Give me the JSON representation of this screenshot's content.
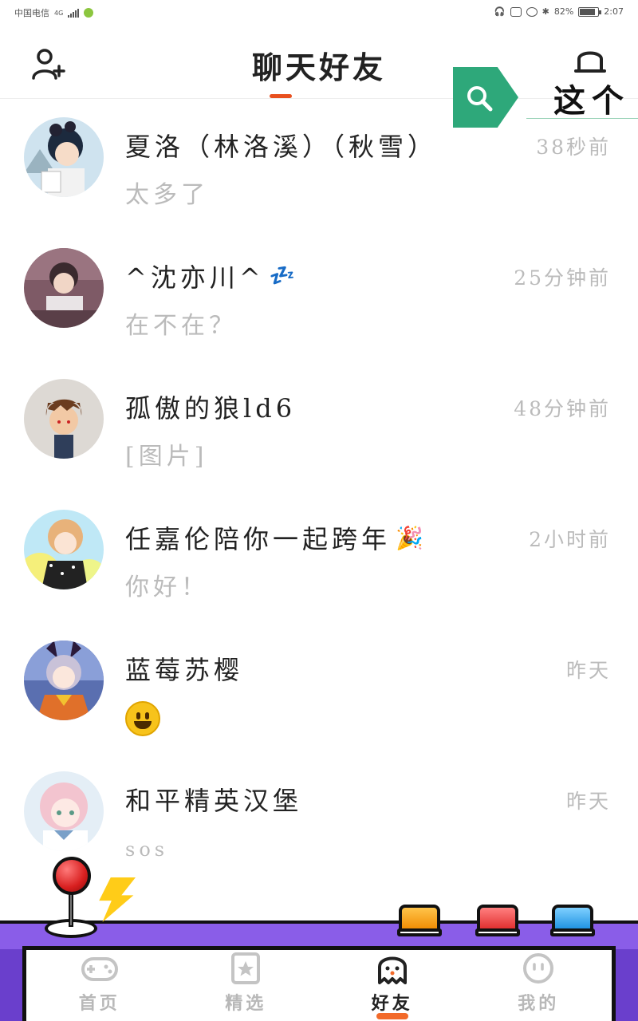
{
  "status_bar": {
    "carrier": "中国电信",
    "network": "4G",
    "battery": "82%",
    "time": "2:07"
  },
  "header": {
    "title": "聊天好友"
  },
  "search_badge": {
    "text": "这个"
  },
  "chats": [
    {
      "name": "夏洛（林洛溪）（秋雪）",
      "message": "太多了",
      "time": "38秒前"
    },
    {
      "name": "^沈亦川^",
      "name_emoji": "💤",
      "message": "在不在？",
      "time": "25分钟前"
    },
    {
      "name": "孤傲的狼ld6",
      "message": "[图片]",
      "time": "48分钟前"
    },
    {
      "name": "任嘉伦陪你一起跨年",
      "name_emoji": "🎉",
      "message": "你好！",
      "time": "2小时前"
    },
    {
      "name": "蓝莓苏樱",
      "message_icon": "grinning-face",
      "time": "昨天"
    },
    {
      "name": "和平精英汉堡",
      "message": "sos",
      "time": "昨天"
    }
  ],
  "tabs": [
    {
      "label": "首页",
      "icon": "gamepad-icon",
      "active": false
    },
    {
      "label": "精选",
      "icon": "star-bookmark-icon",
      "active": false
    },
    {
      "label": "好友",
      "icon": "ghost-icon",
      "active": true
    },
    {
      "label": "我的",
      "icon": "smiley-face-icon",
      "active": false
    }
  ],
  "colors": {
    "accent": "#e8501f",
    "search_green": "#2ea87a",
    "arcade_purple": "#8a5de8"
  }
}
